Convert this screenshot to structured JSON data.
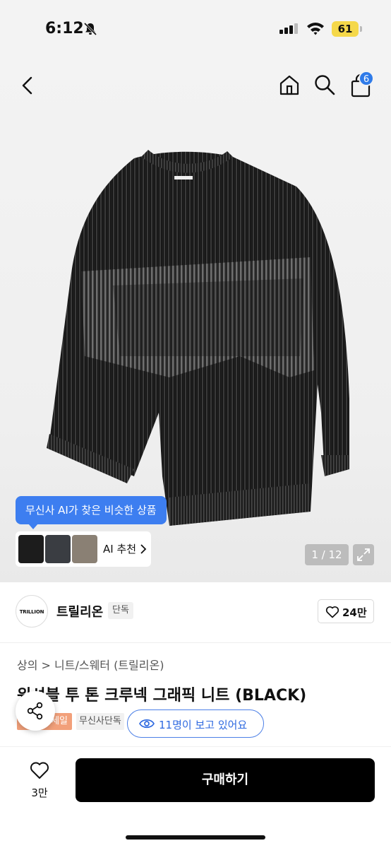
{
  "status_bar": {
    "time": "6:12",
    "battery": "61"
  },
  "header": {
    "cart_count": "6"
  },
  "gallery": {
    "ai_tooltip": "무신사 AI가 찾은 비슷한 상품",
    "ai_recommend_label": "AI 추천",
    "image_counter": "1 / 12"
  },
  "brand": {
    "logo_text": "TRILLION",
    "name": "트릴리온",
    "tag": "단독",
    "like_count": "24만"
  },
  "product": {
    "breadcrumb": "상의 > 니트/스웨터 (트릴리온)",
    "title": "워셔블 투 톤 크루넥 그래픽 니트 (BLACK)",
    "sale_tag": "세일",
    "exclusive_tag": "무신사단독",
    "viewers": "11명이 보고 있어요"
  },
  "bottom_bar": {
    "favorite_count": "3만",
    "buy_label": "구매하기"
  },
  "colors": {
    "accent": "#3d7ef0",
    "buy_button": "#000000"
  },
  "icons": [
    "bell-slash-icon",
    "signal-icon",
    "wifi-icon",
    "back-icon",
    "home-icon",
    "search-icon",
    "cart-icon",
    "expand-icon",
    "heart-icon",
    "eye-icon",
    "share-icon"
  ]
}
